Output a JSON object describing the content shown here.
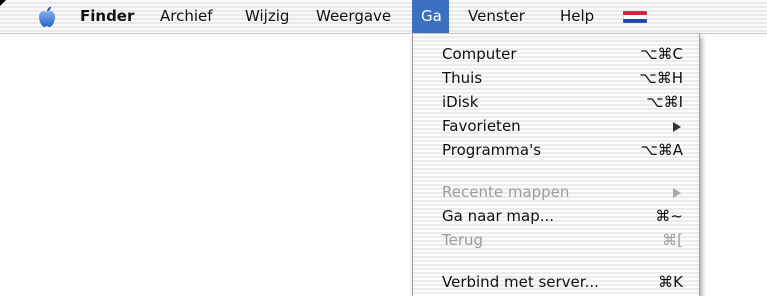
{
  "menubar": {
    "apple_icon": "apple-icon",
    "items": [
      {
        "label": "Finder"
      },
      {
        "label": "Archief"
      },
      {
        "label": "Wijzig"
      },
      {
        "label": "Weergave"
      },
      {
        "label": "Ga",
        "active": true
      },
      {
        "label": "Venster"
      },
      {
        "label": "Help"
      }
    ],
    "flag_icon": "dutch-flag-icon",
    "active_color": "#3d6fc0"
  },
  "go_menu": {
    "items": [
      {
        "label": "Computer",
        "shortcut": "⌥⌘C"
      },
      {
        "label": "Thuis",
        "shortcut": "⌥⌘H"
      },
      {
        "label": "iDisk",
        "shortcut": "⌥⌘I"
      },
      {
        "label": "Favorieten",
        "submenu": true
      },
      {
        "label": "Programma's",
        "shortcut": "⌥⌘A"
      },
      {
        "label": "Recente mappen",
        "submenu": true,
        "disabled": true
      },
      {
        "label": "Ga naar map...",
        "shortcut": "⌘~"
      },
      {
        "label": "Terug",
        "shortcut": "⌘[",
        "disabled": true
      },
      {
        "label": "Verbind met server...",
        "shortcut": "⌘K"
      }
    ]
  }
}
